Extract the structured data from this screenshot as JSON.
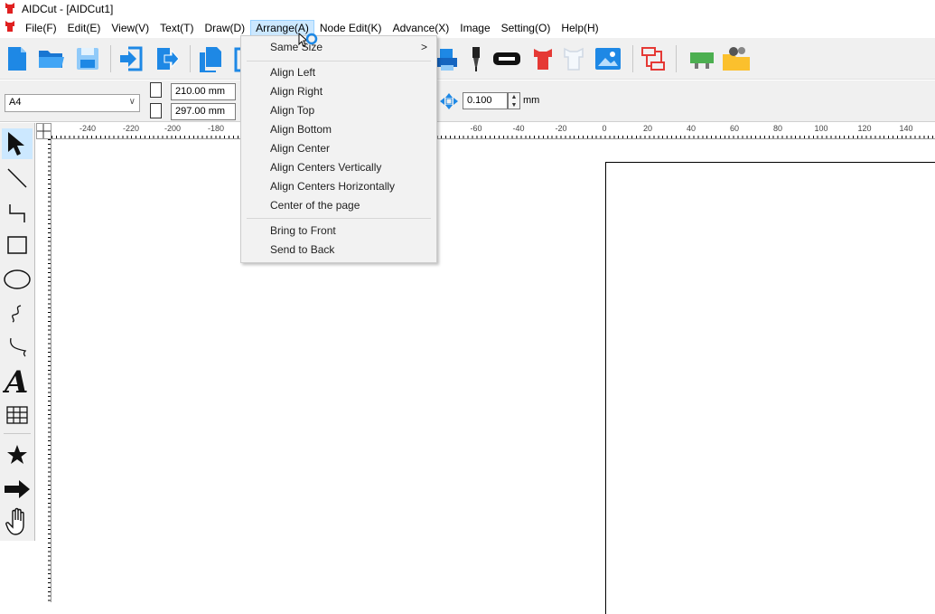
{
  "window": {
    "title": "AIDCut - [AIDCut1]"
  },
  "menubar": {
    "items": [
      {
        "id": "file",
        "label": "File(F)"
      },
      {
        "id": "edit",
        "label": "Edit(E)"
      },
      {
        "id": "view",
        "label": "View(V)"
      },
      {
        "id": "text",
        "label": "Text(T)"
      },
      {
        "id": "draw",
        "label": "Draw(D)"
      },
      {
        "id": "arrange",
        "label": "Arrange(A)"
      },
      {
        "id": "node-edit",
        "label": "Node Edit(K)"
      },
      {
        "id": "advance",
        "label": "Advance(X)"
      },
      {
        "id": "image",
        "label": "Image"
      },
      {
        "id": "setting",
        "label": "Setting(O)"
      },
      {
        "id": "help",
        "label": "Help(H)"
      }
    ],
    "active": "arrange"
  },
  "arrange_menu": {
    "items": [
      {
        "label": "Same Size",
        "has_submenu": true
      },
      {
        "label": "Align Left"
      },
      {
        "label": "Align Right"
      },
      {
        "label": "Align Top"
      },
      {
        "label": "Align Bottom"
      },
      {
        "label": "Align Center"
      },
      {
        "label": "Align Centers Vertically"
      },
      {
        "label": "Align Centers Horizontally"
      },
      {
        "label": "Center of the page"
      },
      {
        "label": "Bring to Front"
      },
      {
        "label": "Send to Back"
      }
    ],
    "submenu_arrow": ">"
  },
  "propbar": {
    "page_size": "A4",
    "width": "210.00 mm",
    "height": "297.00 mm",
    "step": "0.100",
    "step_unit": "mm"
  },
  "ruler": {
    "labels": [
      "-240",
      "-220",
      "-200",
      "-180",
      "-60",
      "-40",
      "-20",
      "0",
      "20",
      "40",
      "60",
      "80",
      "100",
      "120",
      "140"
    ]
  },
  "colors": {
    "accent": "#0078d7",
    "menu_highlight": "#cce8ff",
    "toolbar_bg": "#f0f0f0"
  }
}
